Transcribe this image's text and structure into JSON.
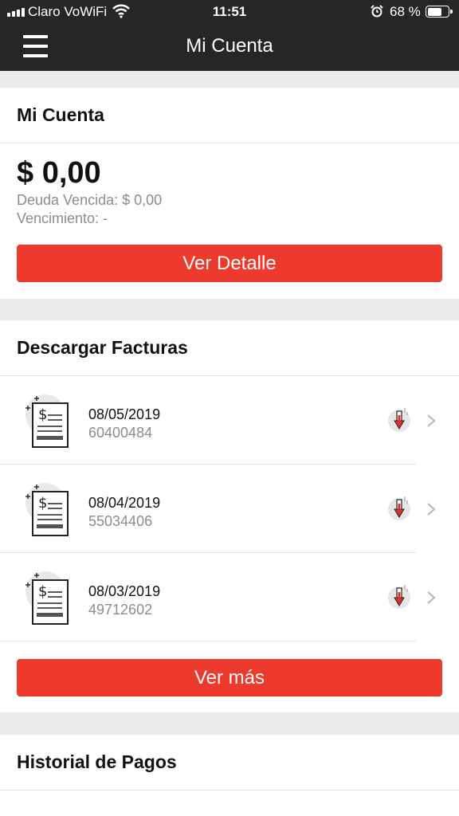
{
  "status_bar": {
    "carrier": "Claro VoWiFi",
    "time": "11:51",
    "battery": "68 %",
    "battery_level": 0.68
  },
  "header": {
    "title": "Mi Cuenta"
  },
  "account": {
    "title": "Mi Cuenta",
    "amount": "$ 0,00",
    "overdue": "Deuda Vencida: $ 0,00",
    "due": "Vencimiento: -",
    "detail_button": "Ver Detalle"
  },
  "invoices": {
    "title": "Descargar Facturas",
    "items": [
      {
        "date": "08/05/2019",
        "number": "60400484"
      },
      {
        "date": "08/04/2019",
        "number": "55034406"
      },
      {
        "date": "08/03/2019",
        "number": "49712602"
      }
    ],
    "more_button": "Ver más"
  },
  "history": {
    "title": "Historial de Pagos"
  },
  "colors": {
    "accent": "#ee3a2c",
    "header_bg": "#262626",
    "page_bg": "#ebebeb"
  },
  "icons": [
    "menu-icon",
    "wifi-icon",
    "alarm-icon",
    "battery-icon",
    "invoice-document-icon",
    "download-icon",
    "chevron-right-icon"
  ]
}
